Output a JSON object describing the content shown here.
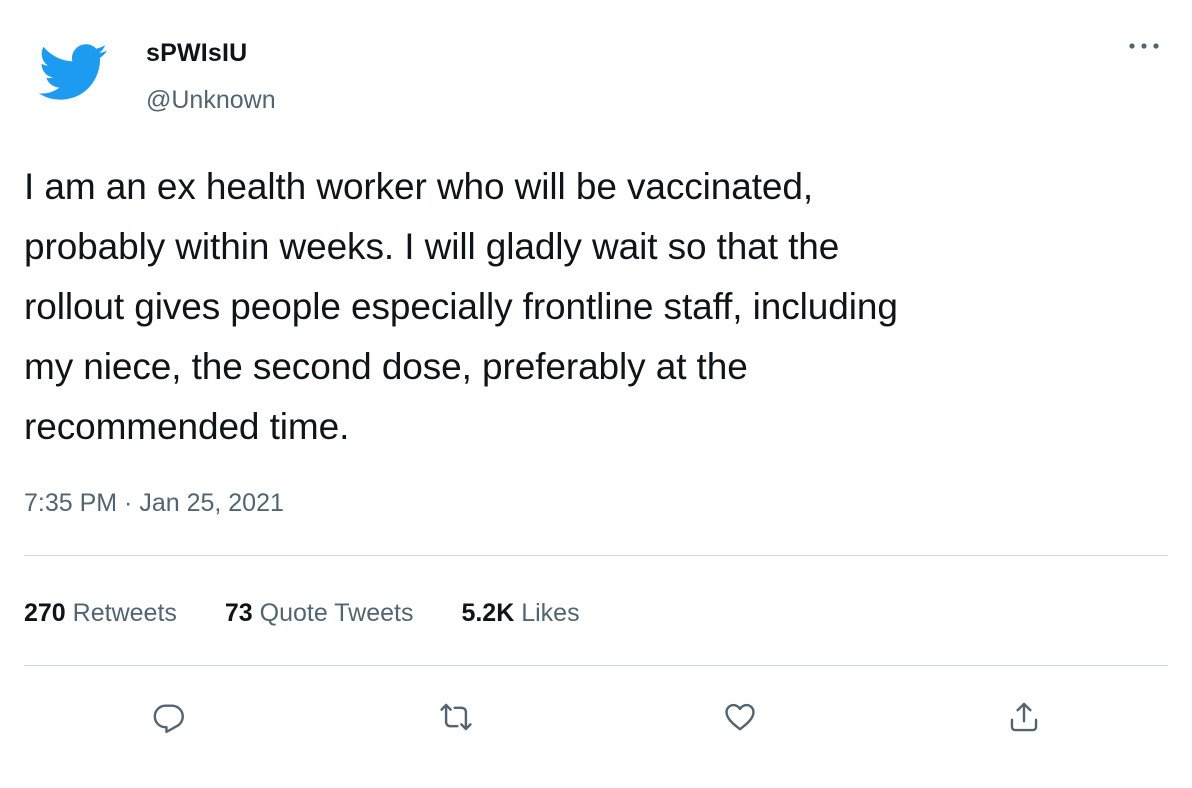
{
  "author": {
    "display_name": "sPWIsIU",
    "handle": "@Unknown",
    "avatar_icon": "twitter-bird-icon"
  },
  "tweet": {
    "text": "I am an ex health worker who will be vaccinated, probably within weeks. I will gladly wait so that the rollout gives people especially frontline staff, including my niece, the second dose, preferably at the recommended time.",
    "text_lines": [
      "I am an ex health worker who will be vaccinated,",
      "probably within weeks. I will gladly wait so that the",
      "rollout gives people especially frontline staff, including",
      "my niece, the second dose, preferably at the",
      "recommended time."
    ],
    "timestamp": "7:35 PM · Jan 25, 2021"
  },
  "stats": {
    "retweets_count": "270",
    "retweets_label": "Retweets",
    "quotes_count": "73",
    "quotes_label": "Quote Tweets",
    "likes_count": "5.2K",
    "likes_label": "Likes"
  },
  "actions": {
    "reply_icon": "reply-icon",
    "retweet_icon": "retweet-icon",
    "like_icon": "heart-icon",
    "share_icon": "share-icon",
    "more_icon": "more-options-icon"
  },
  "colors": {
    "brand_blue": "#1d9bf0",
    "text_primary": "#0f1419",
    "text_secondary": "#536471",
    "divider": "#cfd9de"
  }
}
